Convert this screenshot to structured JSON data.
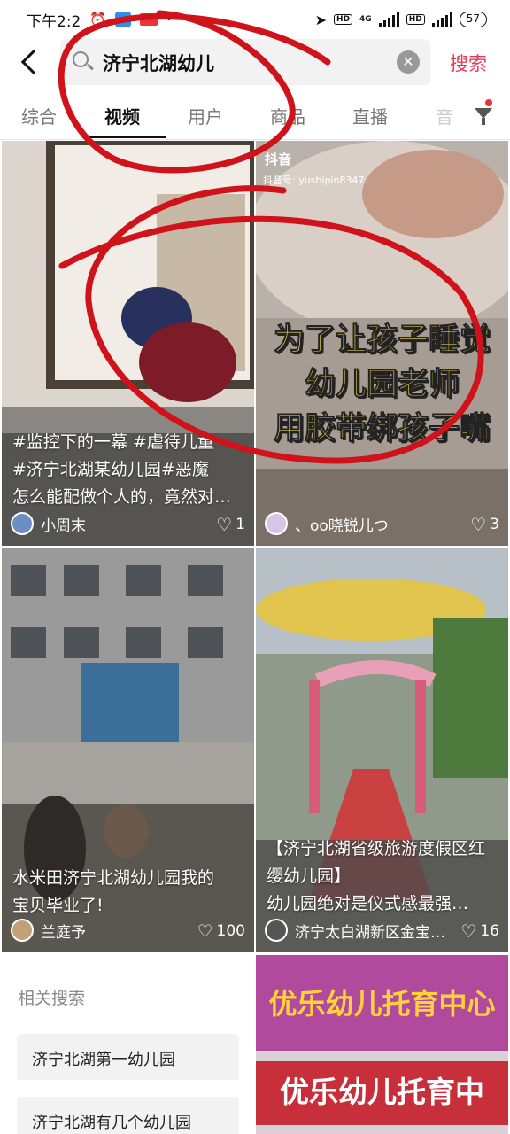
{
  "status_bar": {
    "time": "下午2:2",
    "network_label": "4G",
    "hd_label": "HD",
    "battery": "57"
  },
  "search": {
    "query": "济宁北湖幼儿",
    "search_button": "搜索"
  },
  "tabs": [
    {
      "label": "综合",
      "active": false
    },
    {
      "label": "视频",
      "active": true
    },
    {
      "label": "用户",
      "active": false
    },
    {
      "label": "商品",
      "active": false
    },
    {
      "label": "直播",
      "active": false
    },
    {
      "label": "音",
      "active": false
    }
  ],
  "videos": [
    {
      "caption_lines": [
        "#监控下的一幕 #虐待儿童",
        "#济宁北湖某幼儿园#恶魔",
        "怎么能配做个人的，竟然对…"
      ],
      "author": "小周末",
      "likes": "1"
    },
    {
      "overlay_lines": [
        "为了让孩子睡觉",
        "幼儿园老师",
        "用胶带绑孩子嘴"
      ],
      "platform_logo": "抖音",
      "platform_id": "抖音号: yushipin8347",
      "author": "、oo晓锐儿つ",
      "likes": "3"
    },
    {
      "caption_lines": [
        "水米田济宁北湖幼儿园我的",
        "宝贝毕业了!"
      ],
      "author": "兰庭予",
      "likes": "100"
    },
    {
      "caption_lines": [
        "【济宁北湖省级旅游度假区红",
        "缨幼儿园】",
        "幼儿园绝对是仪式感最强…"
      ],
      "author": "济宁太白湖新区金宝…",
      "likes": "16"
    },
    {
      "overlay_lines": [
        "优乐幼儿托育中心",
        "优乐幼儿托育中"
      ]
    }
  ],
  "related_search": {
    "title": "相关搜索",
    "items": [
      "济宁北湖第一幼儿园",
      "济宁北湖有几个幼儿园"
    ]
  },
  "colors": {
    "accent": "#e33a5a",
    "overlay_text": "#ffe94a",
    "scribble": "#d0121b"
  },
  "icons": [
    "back-arrow-icon",
    "search-icon",
    "clear-icon",
    "filter-icon",
    "heart-icon",
    "alarm-icon",
    "location-icon"
  ]
}
